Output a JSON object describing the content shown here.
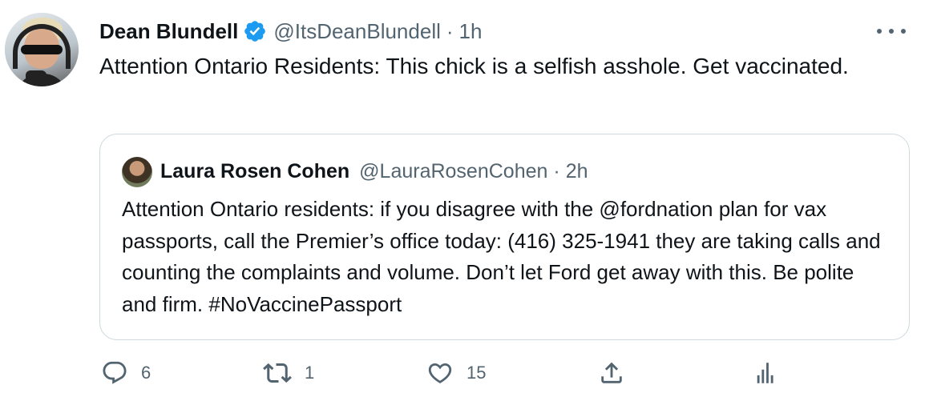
{
  "tweet": {
    "author": {
      "name": "Dean Blundell",
      "handle": "@ItsDeanBlundell",
      "time": "1h",
      "separator": "·",
      "verified_icon": "verified-badge-icon"
    },
    "text": "Attention Ontario Residents:  This chick is a selfish asshole.  Get vaccinated."
  },
  "quote": {
    "author": {
      "name": "Laura Rosen Cohen",
      "handle": "@LauraRosenCohen",
      "time": "2h",
      "separator": "·"
    },
    "text": "Attention Ontario residents: if you disagree with the @fordnation plan for vax passports, call the Premier’s office today: (416) 325-1941 they are taking calls and counting the complaints and volume. Don’t let Ford get away with this. Be polite and firm. #NoVaccinePassport"
  },
  "actions": {
    "reply": {
      "icon": "reply-icon",
      "count": "6"
    },
    "retweet": {
      "icon": "retweet-icon",
      "count": "1"
    },
    "like": {
      "icon": "heart-icon",
      "count": "15"
    },
    "share": {
      "icon": "share-icon"
    },
    "analytics": {
      "icon": "analytics-icon"
    }
  },
  "colors": {
    "text": "#0f1419",
    "secondary": "#536471",
    "verified": "#1d9bf0",
    "border": "#cfd9de"
  }
}
